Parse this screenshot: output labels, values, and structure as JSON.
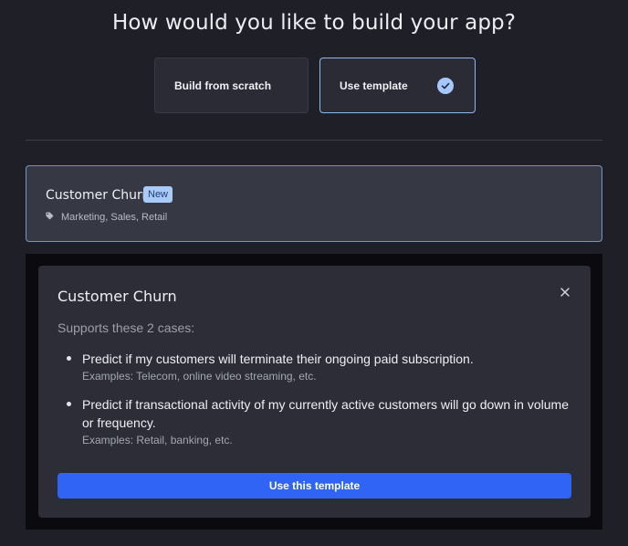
{
  "header": {
    "title": "How would you like to build your app?"
  },
  "build_options": [
    {
      "label": "Build from scratch",
      "selected": false
    },
    {
      "label": "Use template",
      "selected": true
    }
  ],
  "template_card": {
    "title": "Customer Churn",
    "badge": "New",
    "tags": "Marketing, Sales, Retail",
    "tag_icon": "tag-icon"
  },
  "modal": {
    "title": "Customer Churn",
    "close_icon": "close-icon",
    "supports": "Supports these 2 cases:",
    "cases": [
      {
        "text": "Predict if my customers will terminate their ongoing paid subscription.",
        "examples": "Examples: Telecom, online video streaming, etc."
      },
      {
        "text": "Predict if transactional activity of my currently active customers will go down in volume or frequency.",
        "examples": "Examples: Retail, banking, etc."
      }
    ],
    "button_label": "Use this template"
  },
  "colors": {
    "accent": "#2f64f5",
    "selected_border": "#8fb7ee",
    "check_fill": "#a6c8ff",
    "badge_bg": "#a9c9f7",
    "background": "#1f2027"
  }
}
